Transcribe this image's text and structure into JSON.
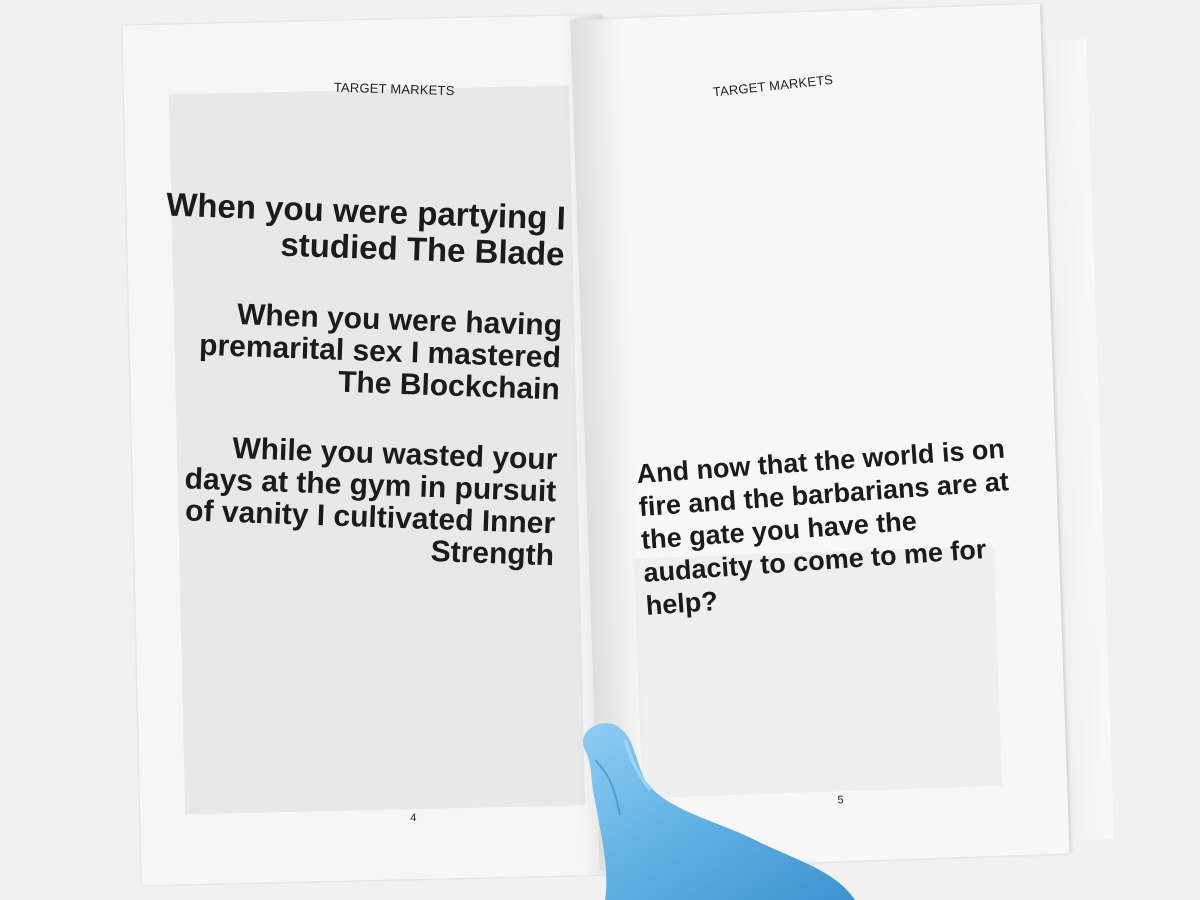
{
  "book": {
    "left_page": {
      "header": "TARGET MARKETS",
      "page_number": "4",
      "stanzas": [
        "When you were partying I studied The Blade",
        "When you were having premarital sex I mastered The Blockchain",
        "While you wasted your days at the gym in pursuit of vanity I cultivated Inner Strength"
      ]
    },
    "right_page": {
      "header": "TARGET MARKETS",
      "page_number": "5",
      "text": "And now that the world is on fire and the barbarians are at the gate you have the audacity to come to me for help?"
    }
  },
  "colors": {
    "background": "#f1f1f2",
    "paper": "#f6f6f6",
    "text": "#1b1b1b",
    "glove": "#6fb8e6"
  }
}
